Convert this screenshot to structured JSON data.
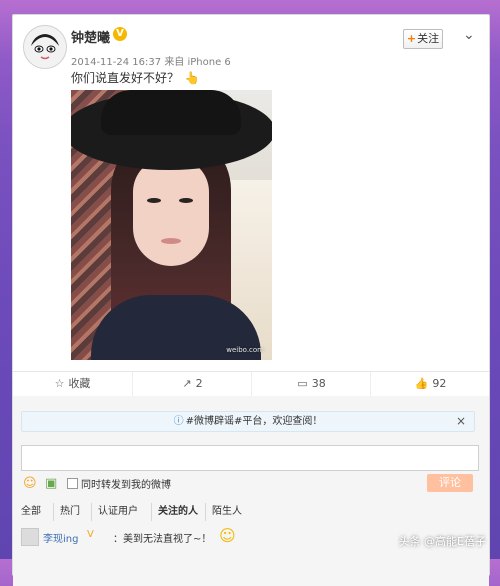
{
  "post": {
    "username": "钟楚曦",
    "follow_label": "关注",
    "timestamp": "2014-11-24 16:37",
    "source": "来自 iPhone 6",
    "text": "你们说直发好不好？",
    "photo_watermark": "weibo.com"
  },
  "actions": {
    "favorite_label": "收藏",
    "forward_count": "2",
    "comment_count": "38",
    "like_count": "92"
  },
  "comments": {
    "notice_text": "#微博辟谣#平台，欢迎查阅！",
    "notice_close": "×",
    "input_placeholder": "",
    "forward_label": "同时转发到我的微博",
    "submit_label": "评论",
    "filters": [
      "全部",
      "热门",
      "认证用户",
      "关注的人",
      "陌生人"
    ],
    "first_comment": {
      "user": "李现ing",
      "text": "：美到无法直视了~！"
    }
  },
  "watermark": "头条 @高能E蓓子",
  "colors": {
    "background_top": "#b66fd0",
    "background_bottom": "#5f45b0",
    "link_blue": "#3d6fb2",
    "submit_orange": "#ffc09f"
  },
  "icons": {
    "favorite": "star-icon",
    "forward": "forward-icon",
    "comment": "comment-icon",
    "like": "thumb-up-icon"
  }
}
